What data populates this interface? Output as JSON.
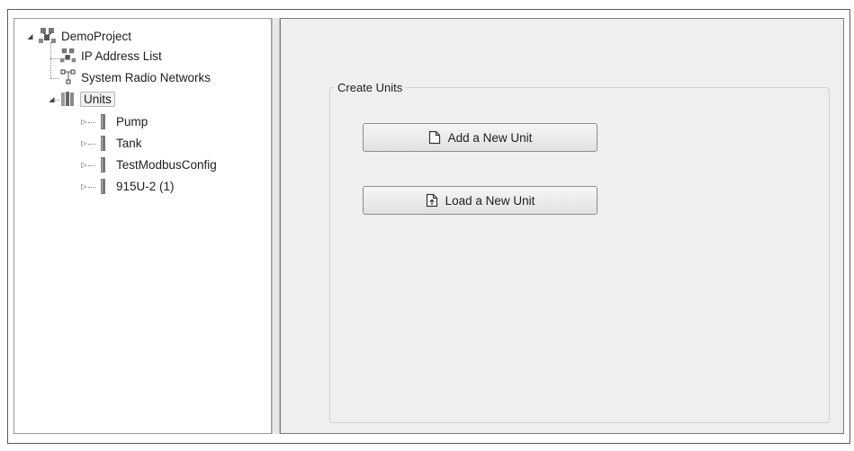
{
  "tree": {
    "root": {
      "label": "DemoProject",
      "icon": "network-project-icon"
    },
    "children": [
      {
        "label": "IP Address List",
        "icon": "network-project-icon"
      },
      {
        "label": "System Radio Networks",
        "icon": "radio-network-icon"
      },
      {
        "label": "Units",
        "icon": "units-icon",
        "selected": true,
        "items": [
          {
            "label": "Pump",
            "icon": "unit-icon"
          },
          {
            "label": "Tank",
            "icon": "unit-icon"
          },
          {
            "label": "TestModbusConfig",
            "icon": "unit-icon"
          },
          {
            "label": "915U-2 (1)",
            "icon": "unit-icon"
          }
        ]
      }
    ]
  },
  "panel": {
    "group_title": "Create Units",
    "add_button": "Add a New Unit",
    "load_button": "Load a New Unit"
  },
  "colors": {
    "panel_bg": "#efefef",
    "border": "#7a7a7a",
    "text": "#1e1e1e"
  }
}
